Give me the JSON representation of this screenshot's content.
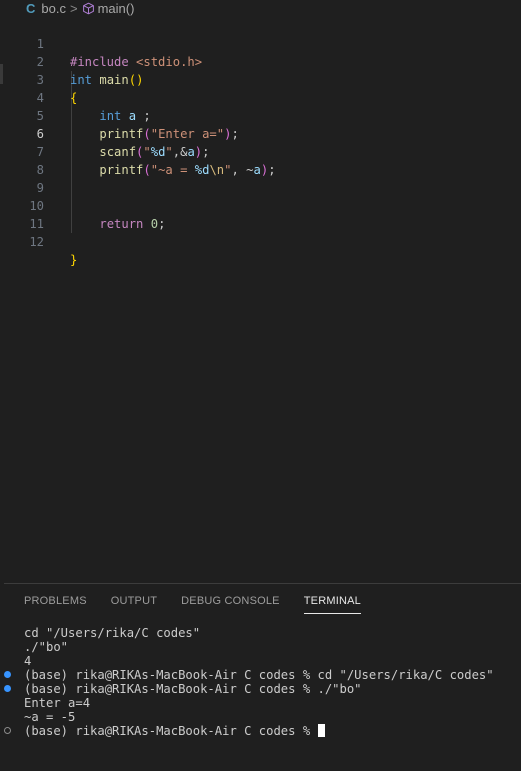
{
  "breadcrumb": {
    "lang_icon": "C",
    "file": "bo.c",
    "separator": ">",
    "symbol_icon": "cube-icon",
    "symbol": "main()"
  },
  "editor": {
    "active_line": 6,
    "lines": [
      {
        "num": "1"
      },
      {
        "num": "2"
      },
      {
        "num": "3"
      },
      {
        "num": "4"
      },
      {
        "num": "5"
      },
      {
        "num": "6"
      },
      {
        "num": "7"
      },
      {
        "num": "8"
      },
      {
        "num": "9"
      },
      {
        "num": "10"
      },
      {
        "num": "11"
      },
      {
        "num": "12"
      }
    ],
    "tokens": {
      "l1": [
        "#include",
        " ",
        "<stdio.h>"
      ],
      "l2": [
        "int",
        " ",
        "main",
        "(",
        ")"
      ],
      "l3": [
        "{"
      ],
      "l4": [
        "    ",
        "int",
        " ",
        "a",
        " ;"
      ],
      "l5": [
        "    ",
        "printf",
        "(",
        "\"Enter a=\"",
        ")",
        ";"
      ],
      "l6": [
        "    ",
        "scanf",
        "(",
        "\"",
        "%d",
        "\"",
        ",&",
        "a",
        ")",
        ";"
      ],
      "l7": [
        "    ",
        "printf",
        "(",
        "\"~a = ",
        "%d",
        "\\n",
        "\"",
        ", ~",
        "a",
        ")",
        ";"
      ],
      "l10": [
        "    ",
        "return",
        " ",
        "0",
        ";"
      ],
      "l12": [
        "}"
      ]
    }
  },
  "panel": {
    "tabs": [
      {
        "label": "PROBLEMS"
      },
      {
        "label": "OUTPUT"
      },
      {
        "label": "DEBUG CONSOLE"
      },
      {
        "label": "TERMINAL",
        "active": true
      }
    ]
  },
  "terminal": {
    "lines": [
      {
        "text": "cd \"/Users/rika/C codes\"",
        "marker": "none"
      },
      {
        "text": "./\"bo\"",
        "marker": "none"
      },
      {
        "text": "4",
        "marker": "none"
      },
      {
        "text": "(base) rika@RIKAs-MacBook-Air C codes % cd \"/Users/rika/C codes\"",
        "marker": "blue"
      },
      {
        "text": "(base) rika@RIKAs-MacBook-Air C codes % ./\"bo\"",
        "marker": "blue"
      },
      {
        "text": "Enter a=4",
        "marker": "none"
      },
      {
        "text": "~a = -5",
        "marker": "none"
      },
      {
        "text": "(base) rika@RIKAs-MacBook-Air C codes % ",
        "marker": "hollow"
      }
    ]
  },
  "colors": {
    "background": "#1f1f1f",
    "keyword": "#569cd6",
    "function": "#dcdcaa",
    "string": "#ce9178",
    "variable": "#9cdcfe",
    "number": "#b5cea8",
    "preprocessor": "#c586c0",
    "bracket_gold": "#ffd700",
    "bracket_pink": "#da70d6",
    "terminal_dot": "#3794ff"
  }
}
